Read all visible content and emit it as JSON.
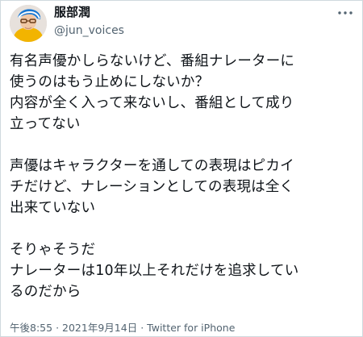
{
  "tweet": {
    "display_name": "服部潤",
    "handle": "@jun_voices",
    "avatar_icon": "profile-photo-icon",
    "more_icon": "more-options-icon",
    "text": "有名声優かしらないけど、番組ナレーターに\n使うのはもう止めにしないか？\n内容が全く入って来ないし、番組として成り\n立ってない\n\n声優はキャラクターを通しての表現はピカイ\nチだけど、ナレーションとしての表現は全く\n出来ていない\n\nそりゃそうだ\nナレーターは10年以上それだけを追求してい\nるのだから",
    "time": "午後8:55",
    "date": "2021年9月14日",
    "separator": "·",
    "source": "Twitter for iPhone"
  }
}
